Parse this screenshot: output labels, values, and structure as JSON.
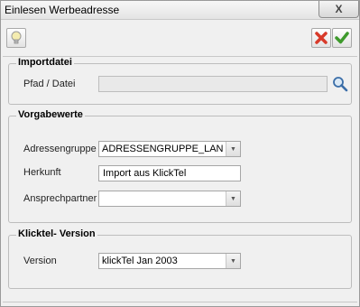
{
  "window": {
    "title": "Einlesen Werbeadresse",
    "close_glyph": "X"
  },
  "toolbar": {
    "hint_icon": "lightbulb-icon",
    "cancel_icon": "red-x-icon",
    "ok_icon": "green-check-icon"
  },
  "importdatei": {
    "title": "Importdatei",
    "path_label": "Pfad / Datei",
    "path_value": "",
    "browse_icon": "magnifier-icon"
  },
  "vorgabewerte": {
    "title": "Vorgabewerte",
    "adressgruppe_label": "Adressengruppe",
    "adressgruppe_value": "ADRESSENGRUPPE_LANG",
    "herkunft_label": "Herkunft",
    "herkunft_value": "Import aus KlickTel",
    "ansprechpartner_label": "Ansprechpartner",
    "ansprechpartner_value": ""
  },
  "klicktel": {
    "title": "Klicktel- Version",
    "version_label": "Version",
    "version_value": "klickTel Jan 2003"
  },
  "colors": {
    "cancel": "#d83a2a",
    "ok": "#3e9a2c",
    "bulb": "#f2e38a"
  }
}
